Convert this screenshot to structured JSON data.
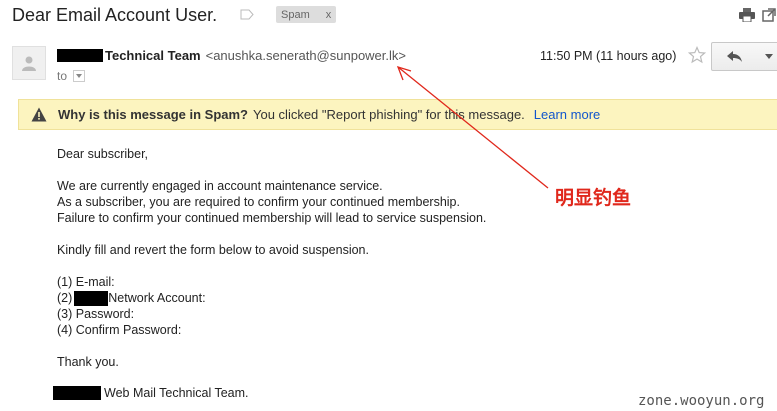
{
  "header": {
    "subject": "Dear Email Account User.",
    "label_chip": "Spam",
    "label_remove": "x",
    "print_icon": "print-icon",
    "popout_icon": "new-window-icon"
  },
  "message": {
    "sender_name": "Technical Team",
    "sender_email": "<anushka.senerath@sunpower.lk>",
    "to_label": "to",
    "time": "11:50 PM (11 hours ago)",
    "star_icon": "star-icon",
    "reply_icon": "reply-icon",
    "more_icon": "chevron-down-icon"
  },
  "spam_banner": {
    "icon": "warning-icon",
    "title": "Why is this message in Spam?",
    "text": "You clicked \"Report phishing\" for this message.",
    "link": "Learn more",
    "bg_color": "#fcf4bf"
  },
  "body": {
    "greeting": "Dear subscriber,",
    "para1": [
      "We are currently engaged in account maintenance service.",
      "As a subscriber, you are required to confirm your continued membership.",
      "Failure to confirm your continued membership will lead to service suspension."
    ],
    "para2": "Kindly fill and revert the form below to avoid suspension.",
    "form": {
      "item1": "(1) E-mail:",
      "item2_prefix": "(2)",
      "item2_suffix": "Network Account:",
      "item3": "(3) Password:",
      "item4": "(4) Confirm Password:"
    },
    "thanks": "Thank you.",
    "signature_suffix": "Web Mail Technical Team."
  },
  "annotation": {
    "text": "明显钓鱼",
    "color": "#e0281c"
  },
  "watermark": "zone.wooyun.org"
}
